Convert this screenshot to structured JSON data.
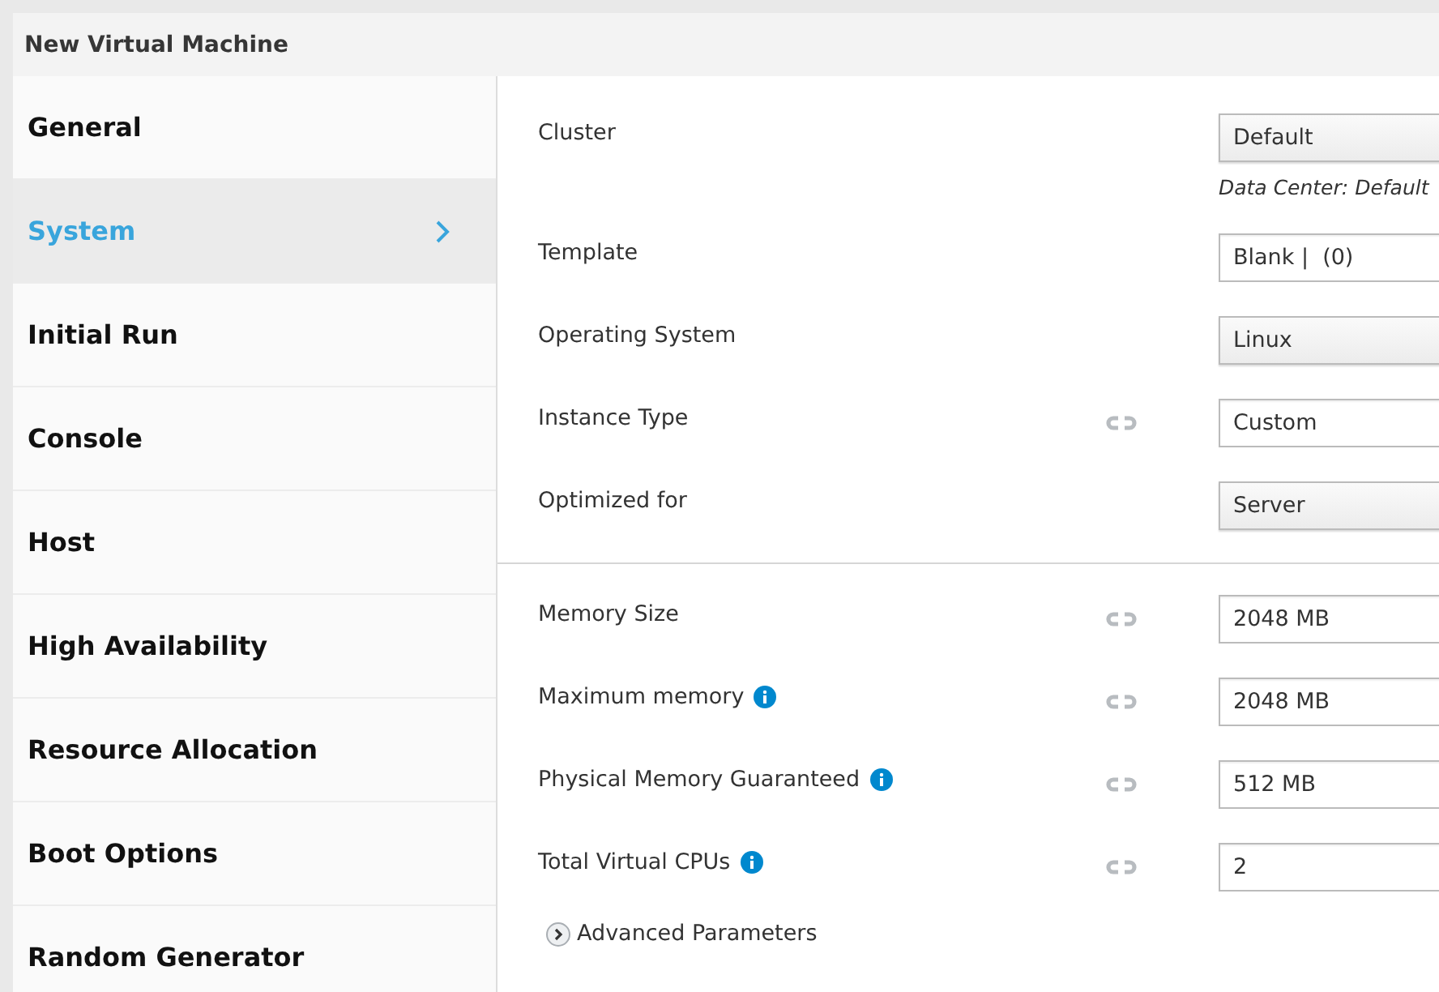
{
  "window": {
    "title": "New Virtual Machine"
  },
  "sidebar": {
    "items": [
      {
        "label": "General",
        "selected": false
      },
      {
        "label": "System",
        "selected": true
      },
      {
        "label": "Initial Run",
        "selected": false
      },
      {
        "label": "Console",
        "selected": false
      },
      {
        "label": "Host",
        "selected": false
      },
      {
        "label": "High Availability",
        "selected": false
      },
      {
        "label": "Resource Allocation",
        "selected": false
      },
      {
        "label": "Boot Options",
        "selected": false
      },
      {
        "label": "Random Generator",
        "selected": false
      }
    ]
  },
  "sections": [
    {
      "fields": [
        {
          "label": "Cluster",
          "kind": "select",
          "value": "Default",
          "linked": false,
          "info": false,
          "note": "Data Center: Default"
        },
        {
          "label": "Template",
          "kind": "text",
          "value": "Blank |  (0)",
          "linked": false,
          "info": false
        },
        {
          "label": "Operating System",
          "kind": "select",
          "value": "Linux",
          "linked": false,
          "info": false
        },
        {
          "label": "Instance Type",
          "kind": "text",
          "value": "Custom",
          "linked": true,
          "info": false
        },
        {
          "label": "Optimized for",
          "kind": "select",
          "value": "Server",
          "linked": false,
          "info": false
        }
      ]
    },
    {
      "fields": [
        {
          "label": "Memory Size",
          "kind": "text",
          "value": "2048 MB",
          "linked": true,
          "info": false
        },
        {
          "label": "Maximum memory",
          "kind": "text",
          "value": "2048 MB",
          "linked": true,
          "info": true
        },
        {
          "label": "Physical Memory Guaranteed",
          "kind": "text",
          "value": "512 MB",
          "linked": true,
          "info": true
        },
        {
          "label": "Total Virtual CPUs",
          "kind": "text",
          "value": "2",
          "linked": true,
          "info": true
        }
      ]
    }
  ],
  "advanced": {
    "label": "Advanced Parameters",
    "expanded": false
  }
}
